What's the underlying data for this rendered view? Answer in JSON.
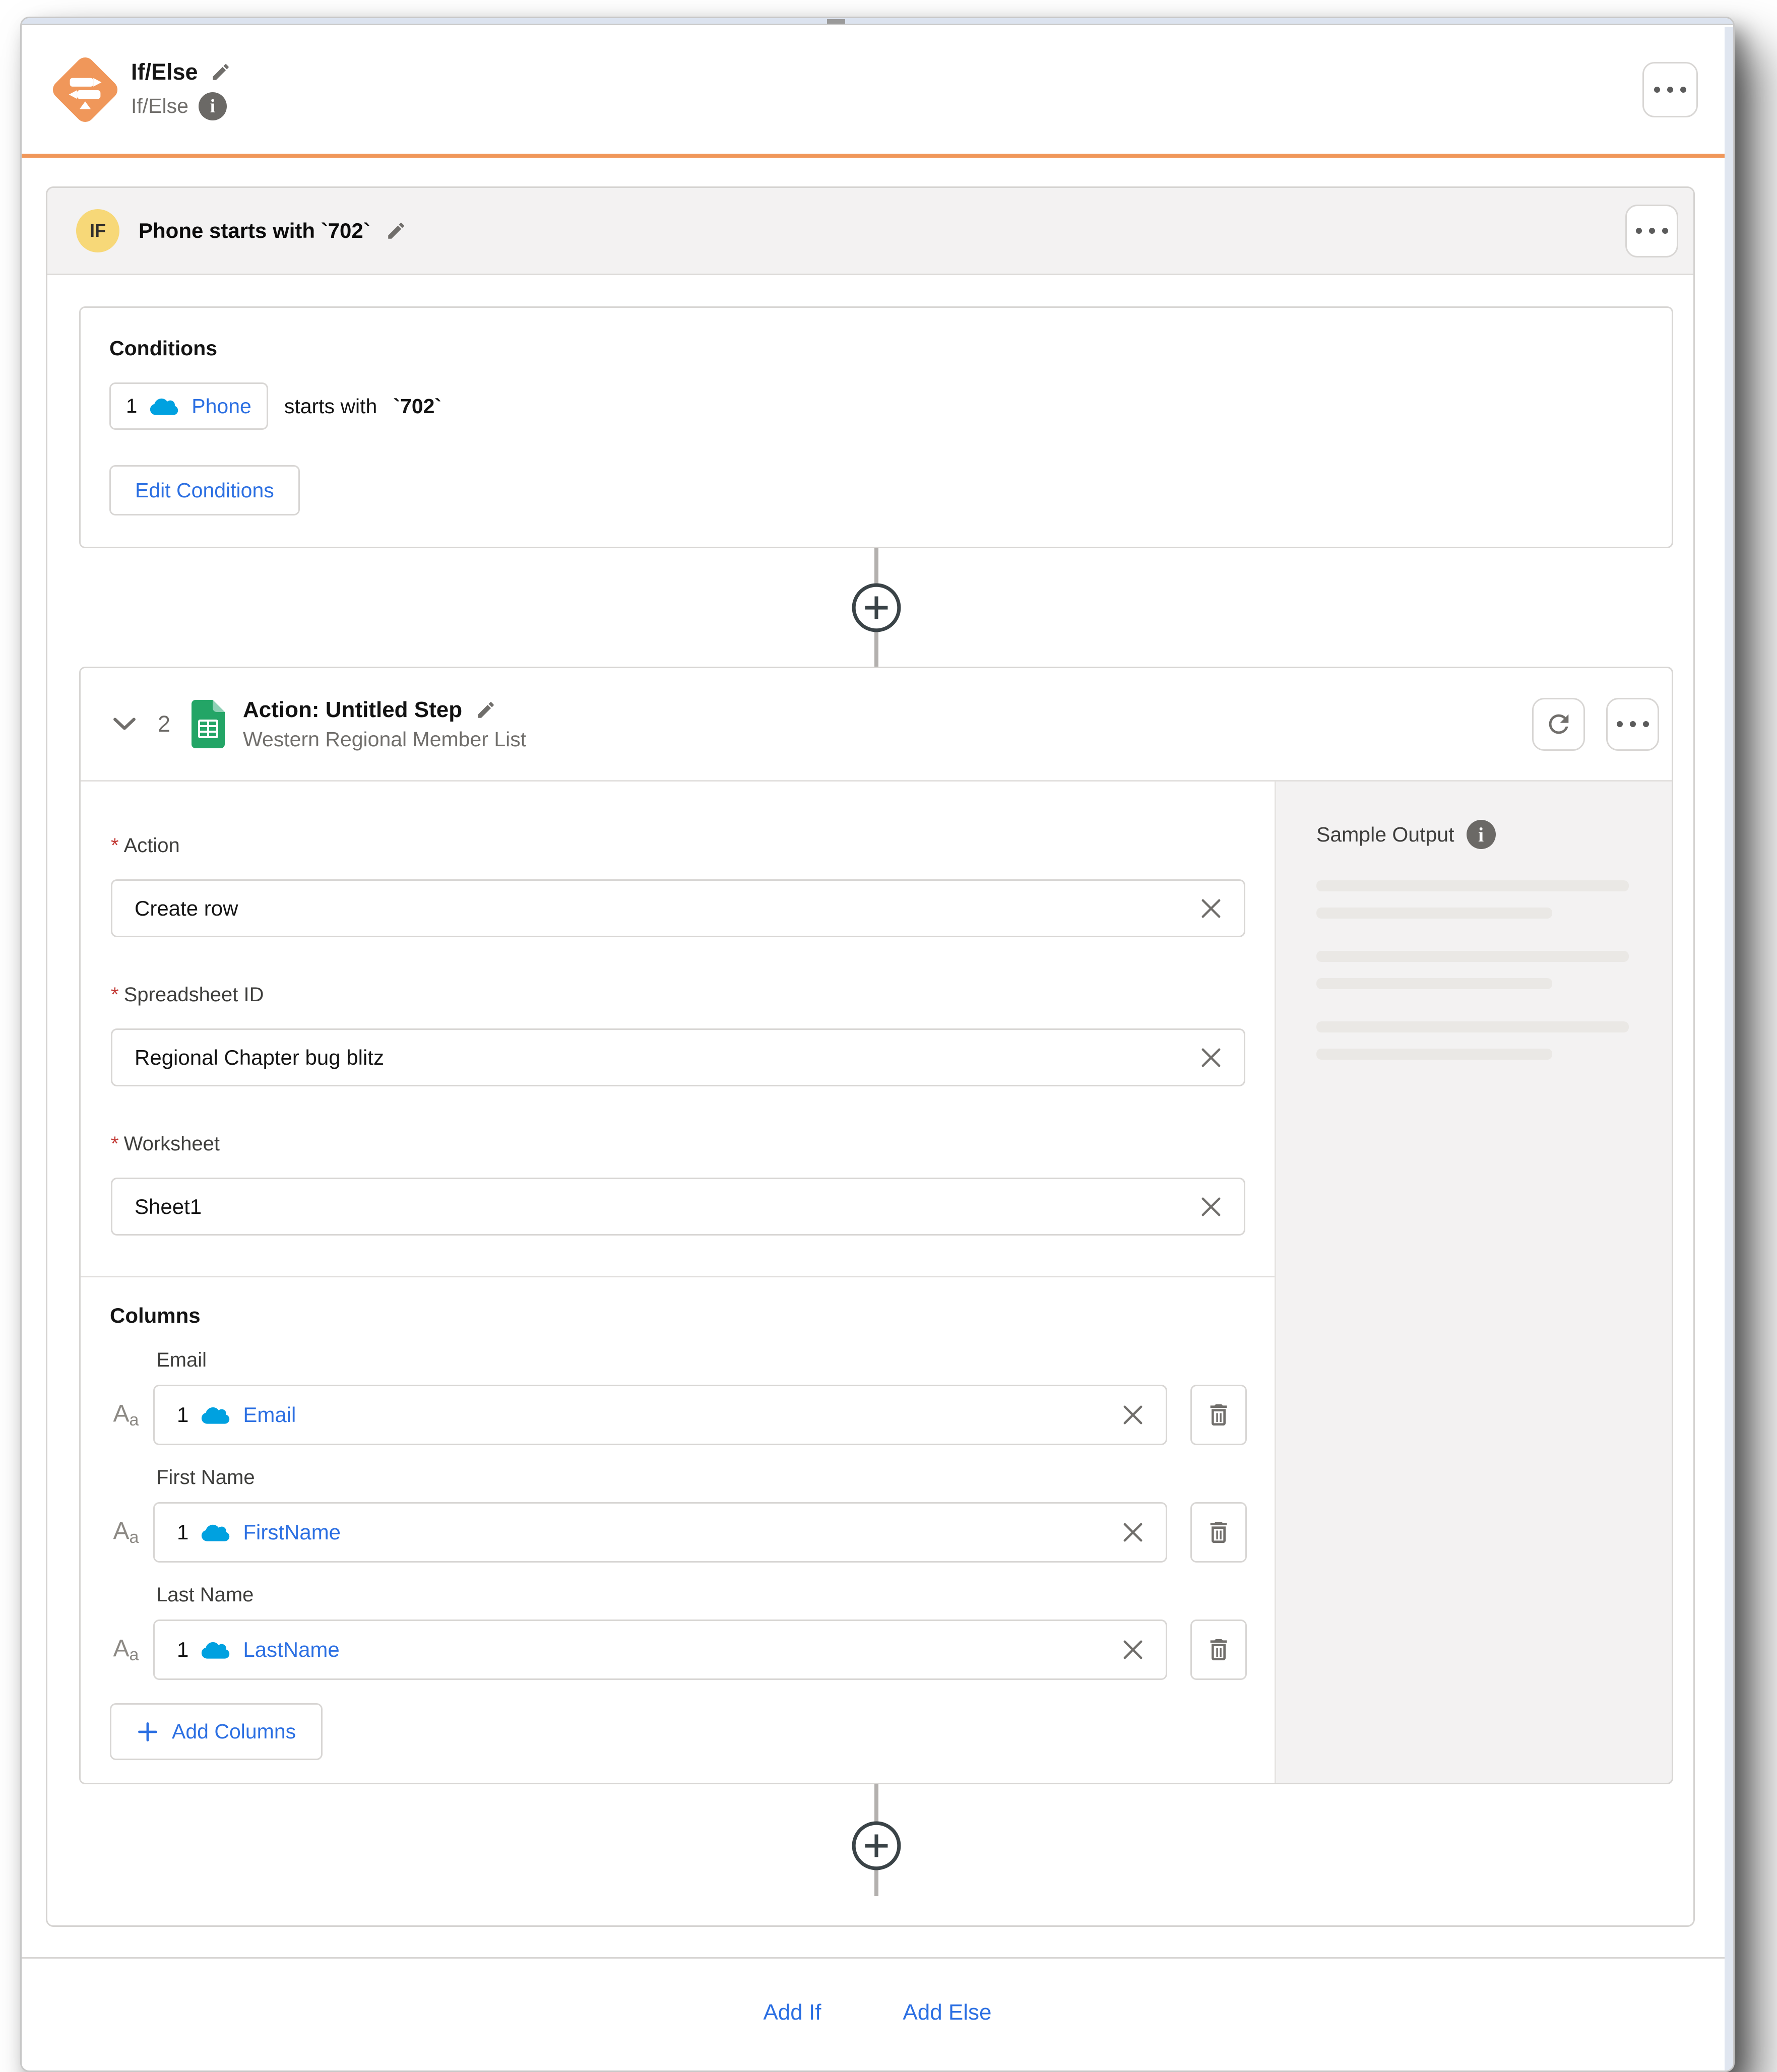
{
  "ui": {
    "required_marker": "*"
  },
  "header": {
    "title": "If/Else",
    "subtitle": "If/Else",
    "menu_icon": "kebab-menu-icon",
    "block_icon": "if-else-signpost-icon"
  },
  "if_block": {
    "badge": "IF",
    "title": "Phone starts with `702`",
    "conditions": {
      "heading": "Conditions",
      "rows": [
        {
          "index": "1",
          "source_icon": "salesforce-cloud-icon",
          "field": "Phone",
          "operator": "starts with",
          "value": "`702`"
        }
      ],
      "edit_button": "Edit Conditions"
    },
    "action_step": {
      "collapse_icon": "chevron-down-icon",
      "number": "2",
      "app_icon": "google-sheets-icon",
      "title": "Action: Untitled Step",
      "subtitle": "Western Regional Member List",
      "fields": [
        {
          "label": "Action",
          "required": true,
          "value": "Create row"
        },
        {
          "label": "Spreadsheet ID",
          "required": true,
          "value": "Regional Chapter bug blitz"
        },
        {
          "label": "Worksheet",
          "required": true,
          "value": "Sheet1"
        }
      ],
      "columns": {
        "heading": "Columns",
        "items": [
          {
            "label": "Email",
            "type_icon": "text-type-Aa-icon",
            "index": "1",
            "source_icon": "salesforce-cloud-icon",
            "value": "Email"
          },
          {
            "label": "First Name",
            "type_icon": "text-type-Aa-icon",
            "index": "1",
            "source_icon": "salesforce-cloud-icon",
            "value": "FirstName"
          },
          {
            "label": "Last Name",
            "type_icon": "text-type-Aa-icon",
            "index": "1",
            "source_icon": "salesforce-cloud-icon",
            "value": "LastName"
          }
        ],
        "add_button": "Add Columns"
      },
      "sample_output": {
        "heading": "Sample Output",
        "info_icon": "info-icon",
        "skeleton_lines": 6
      }
    }
  },
  "footer": {
    "add_if": "Add If",
    "add_else": "Add Else"
  },
  "colors": {
    "accent_orange": "#F0975A",
    "link_blue": "#2B6FE2",
    "salesforce_blue": "#00A1E0",
    "sheets_green": "#23A566",
    "sheets_green_light": "#8ED1B5",
    "if_badge_yellow": "#F7D878",
    "required_red": "#C23934",
    "panel_gray": "#F3F2F2"
  }
}
